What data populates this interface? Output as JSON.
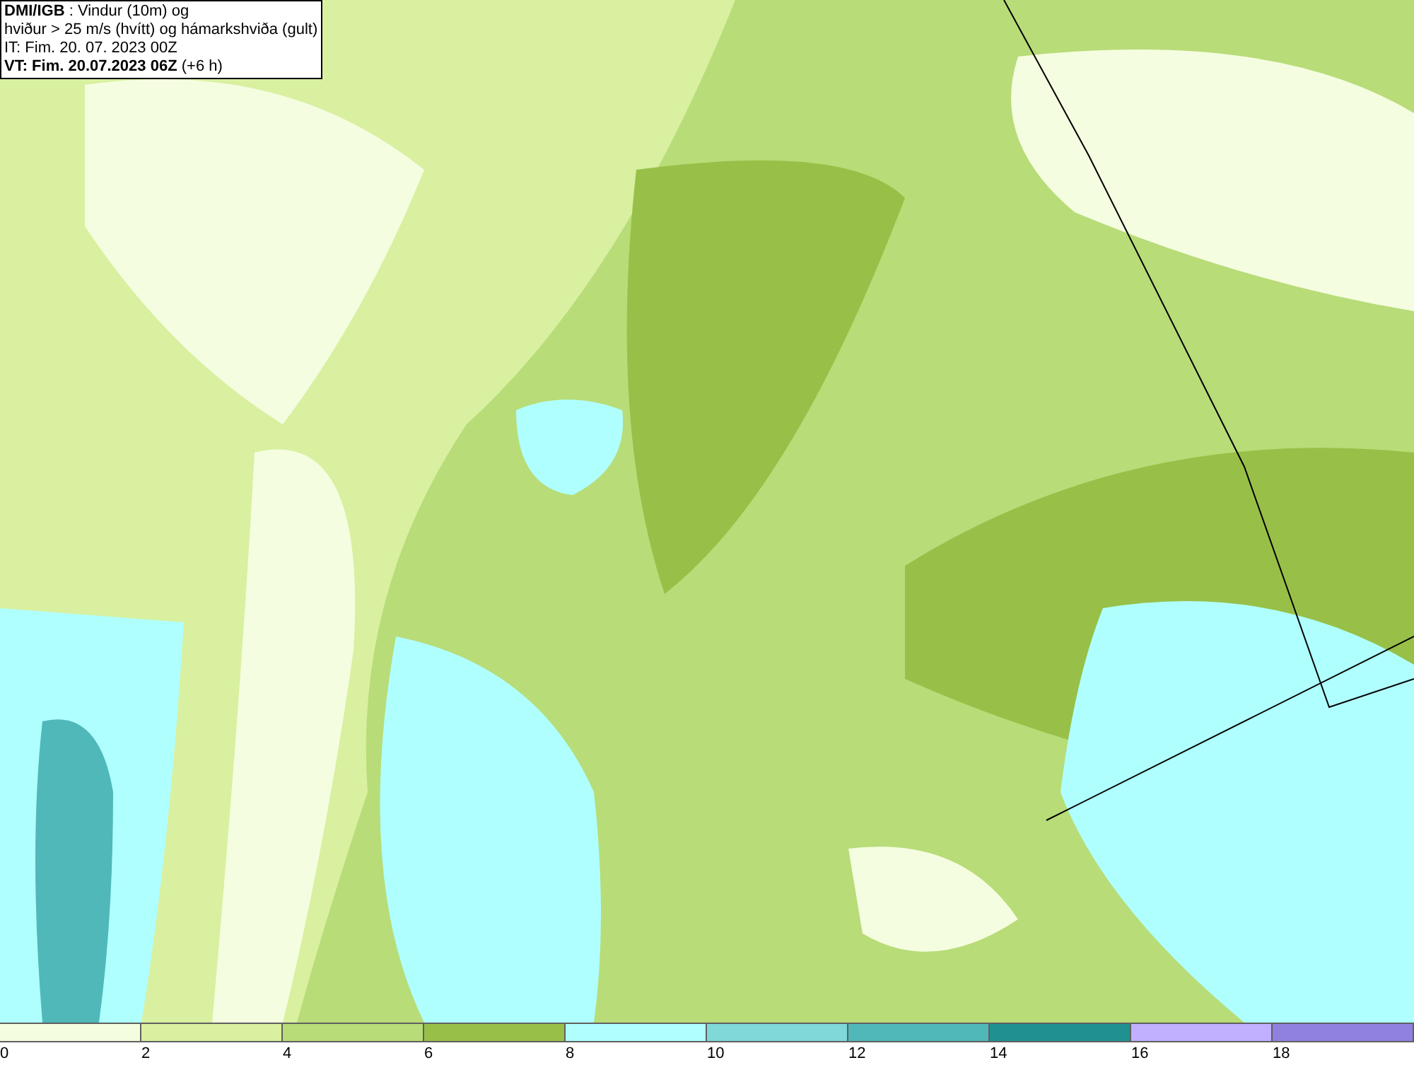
{
  "header": {
    "lines": [
      "**DMI/IGB** : Vindur (10m) og",
      "hviður > 25 m/s (hvítt) og hámarkshviða (gult)",
      "IT: Fim. 20. 07. 2023 00Z",
      "**VT: Fim. 20.07.2023 06Z** (+6 h)"
    ]
  },
  "legend": {
    "bins": [
      {
        "label": "0",
        "color": "#f5fde0"
      },
      {
        "label": "2",
        "color": "#d8f0a0"
      },
      {
        "label": "4",
        "color": "#b8dc78"
      },
      {
        "label": "6",
        "color": "#98c048"
      },
      {
        "label": "8",
        "color": "#b0ffff"
      },
      {
        "label": "10",
        "color": "#80d8d8"
      },
      {
        "label": "12",
        "color": "#50b8b8"
      },
      {
        "label": "14",
        "color": "#209090"
      },
      {
        "label": "16",
        "color": "#c0b0ff"
      },
      {
        "label": "18",
        "color": "#9080e0"
      }
    ]
  }
}
